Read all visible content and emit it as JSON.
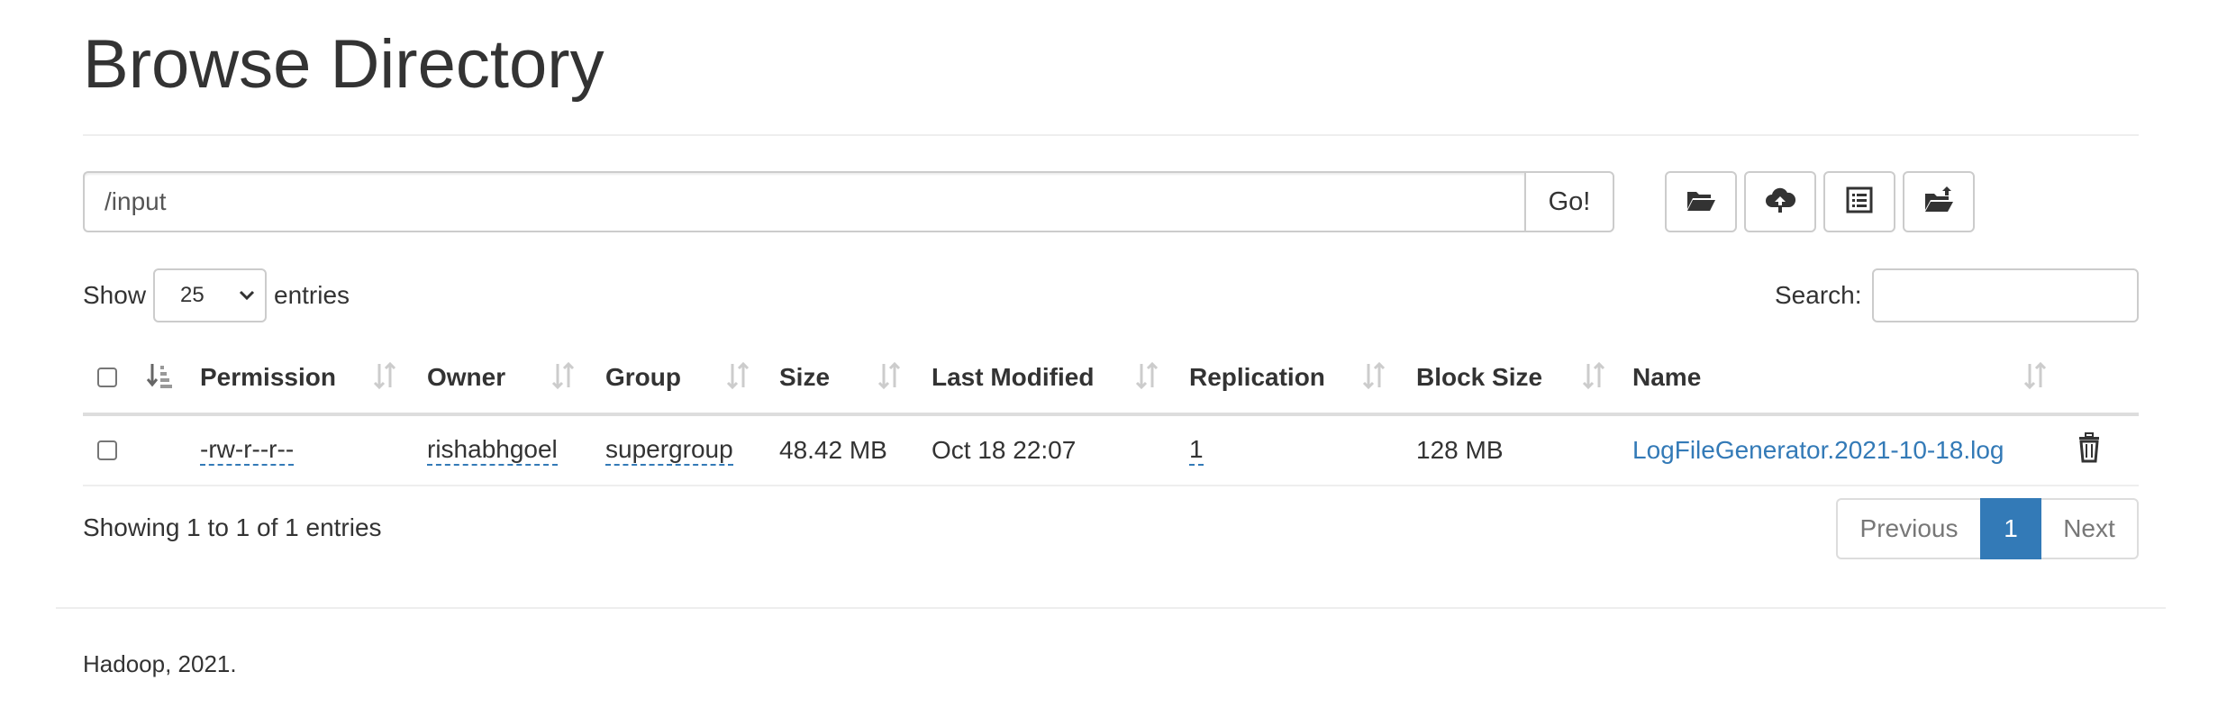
{
  "page": {
    "title": "Browse Directory"
  },
  "path_bar": {
    "value": "/input",
    "go_label": "Go!"
  },
  "toolbar": {
    "buttons": [
      {
        "icon": "folder-open-icon"
      },
      {
        "icon": "cloud-upload-icon"
      },
      {
        "icon": "list-alt-icon"
      },
      {
        "icon": "folder-upload-icon"
      }
    ]
  },
  "controls": {
    "show_label": "Show",
    "entries_value": "25",
    "entries_label": "entries",
    "search_label": "Search:",
    "search_value": ""
  },
  "table": {
    "columns": [
      "Permission",
      "Owner",
      "Group",
      "Size",
      "Last Modified",
      "Replication",
      "Block Size",
      "Name"
    ],
    "rows": [
      {
        "permission": "-rw-r--r--",
        "owner": "rishabhgoel",
        "group": "supergroup",
        "size": "48.42 MB",
        "last_modified": "Oct 18 22:07",
        "replication": "1",
        "block_size": "128 MB",
        "name": "LogFileGenerator.2021-10-18.log"
      }
    ]
  },
  "info": {
    "text": "Showing 1 to 1 of 1 entries"
  },
  "pagination": {
    "previous": "Previous",
    "current": "1",
    "next": "Next"
  },
  "footer": {
    "text": "Hadoop, 2021."
  },
  "colors": {
    "link": "#337ab7",
    "active_page": "#337ab7",
    "text": "#333333"
  }
}
